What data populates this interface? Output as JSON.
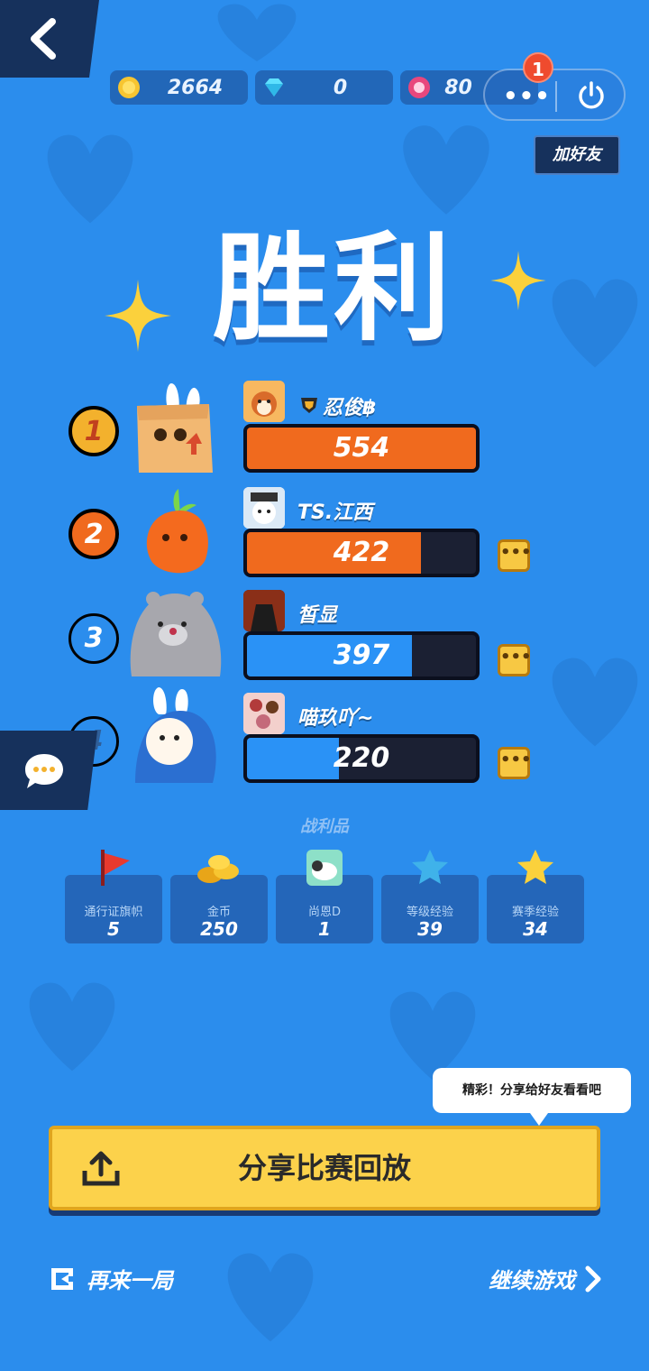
{
  "header": {
    "currencies": [
      {
        "icon": "gold-coin-icon",
        "value": "2664"
      },
      {
        "icon": "diamond-icon",
        "value": "0"
      },
      {
        "icon": "flower-token-icon",
        "value": "80"
      }
    ],
    "notification_count": "1",
    "more_label": "•••",
    "add_friend_label": "加好友"
  },
  "title": "胜利",
  "players": [
    {
      "rank": "1",
      "name": "忍俊฿",
      "score": "554",
      "progress": 1.0,
      "bar_color": "#f06a1e"
    },
    {
      "rank": "2",
      "name": "TS.江西",
      "score": "422",
      "progress": 0.76,
      "bar_color": "#f06a1e"
    },
    {
      "rank": "3",
      "name": "皙显",
      "score": "397",
      "progress": 0.72,
      "bar_color": "#2a92f6"
    },
    {
      "rank": "4",
      "name": "喵玖吖~",
      "score": "220",
      "progress": 0.4,
      "bar_color": "#2a92f6"
    }
  ],
  "loot": {
    "title": "战利品",
    "items": [
      {
        "label": "通行证旗帜",
        "value": "5",
        "icon": "red-flag-icon"
      },
      {
        "label": "金币",
        "value": "250",
        "icon": "coin-pile-icon"
      },
      {
        "label": "尚恩D",
        "value": "1",
        "icon": "sheep-card-icon"
      },
      {
        "label": "等级经验",
        "value": "39",
        "icon": "blue-star-icon"
      },
      {
        "label": "赛季经验",
        "value": "34",
        "icon": "yellow-star-icon"
      }
    ]
  },
  "tooltip": "精彩！分享给好友看看吧",
  "share_button": "分享比赛回放",
  "replay_label": "再来一局",
  "continue_label": "继续游戏",
  "colors": {
    "background": "#2b8ded",
    "share": "#fcd24b",
    "dark_panel": "#16315c"
  }
}
